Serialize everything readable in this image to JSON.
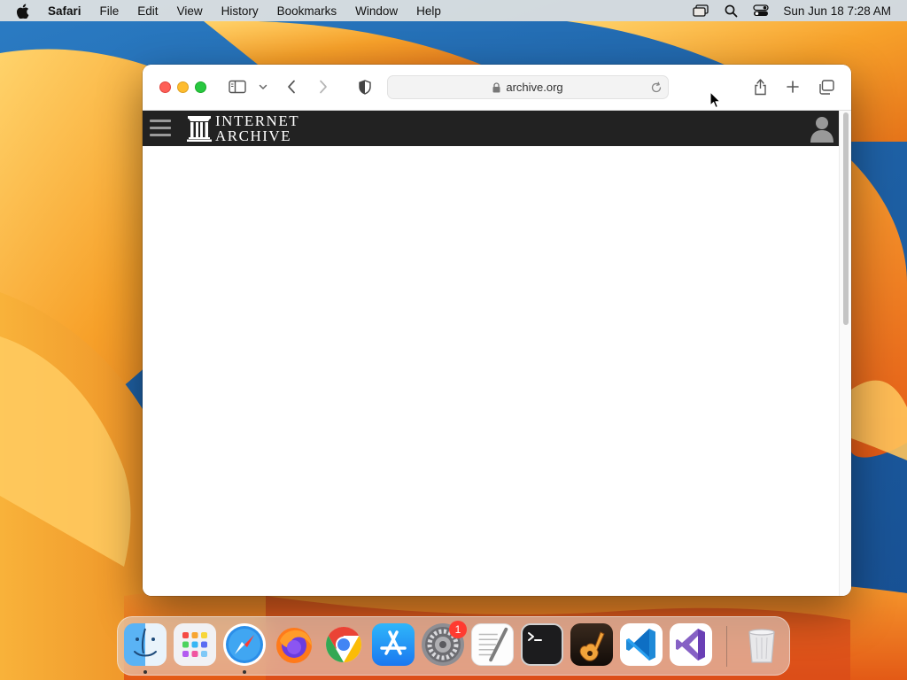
{
  "menubar": {
    "app_name": "Safari",
    "items": [
      "File",
      "Edit",
      "View",
      "History",
      "Bookmarks",
      "Window",
      "Help"
    ],
    "clock": "Sun Jun 18  7:28 AM"
  },
  "browser": {
    "url": "archive.org"
  },
  "site": {
    "logo_line1": "INTERNET",
    "logo_line2": "ARCHIVE"
  },
  "dock": {
    "apps": [
      "Finder",
      "Launchpad",
      "Safari",
      "Firefox",
      "Chrome",
      "App Store",
      "System Settings",
      "TextEdit",
      "Terminal",
      "GarageBand",
      "Visual Studio Code",
      "Visual Studio",
      "Trash"
    ],
    "settings_badge": "1"
  },
  "colors": {
    "ia_header": "#222222",
    "accent_red": "#fe5f57",
    "accent_yellow": "#febc2e",
    "accent_green": "#28c840"
  }
}
